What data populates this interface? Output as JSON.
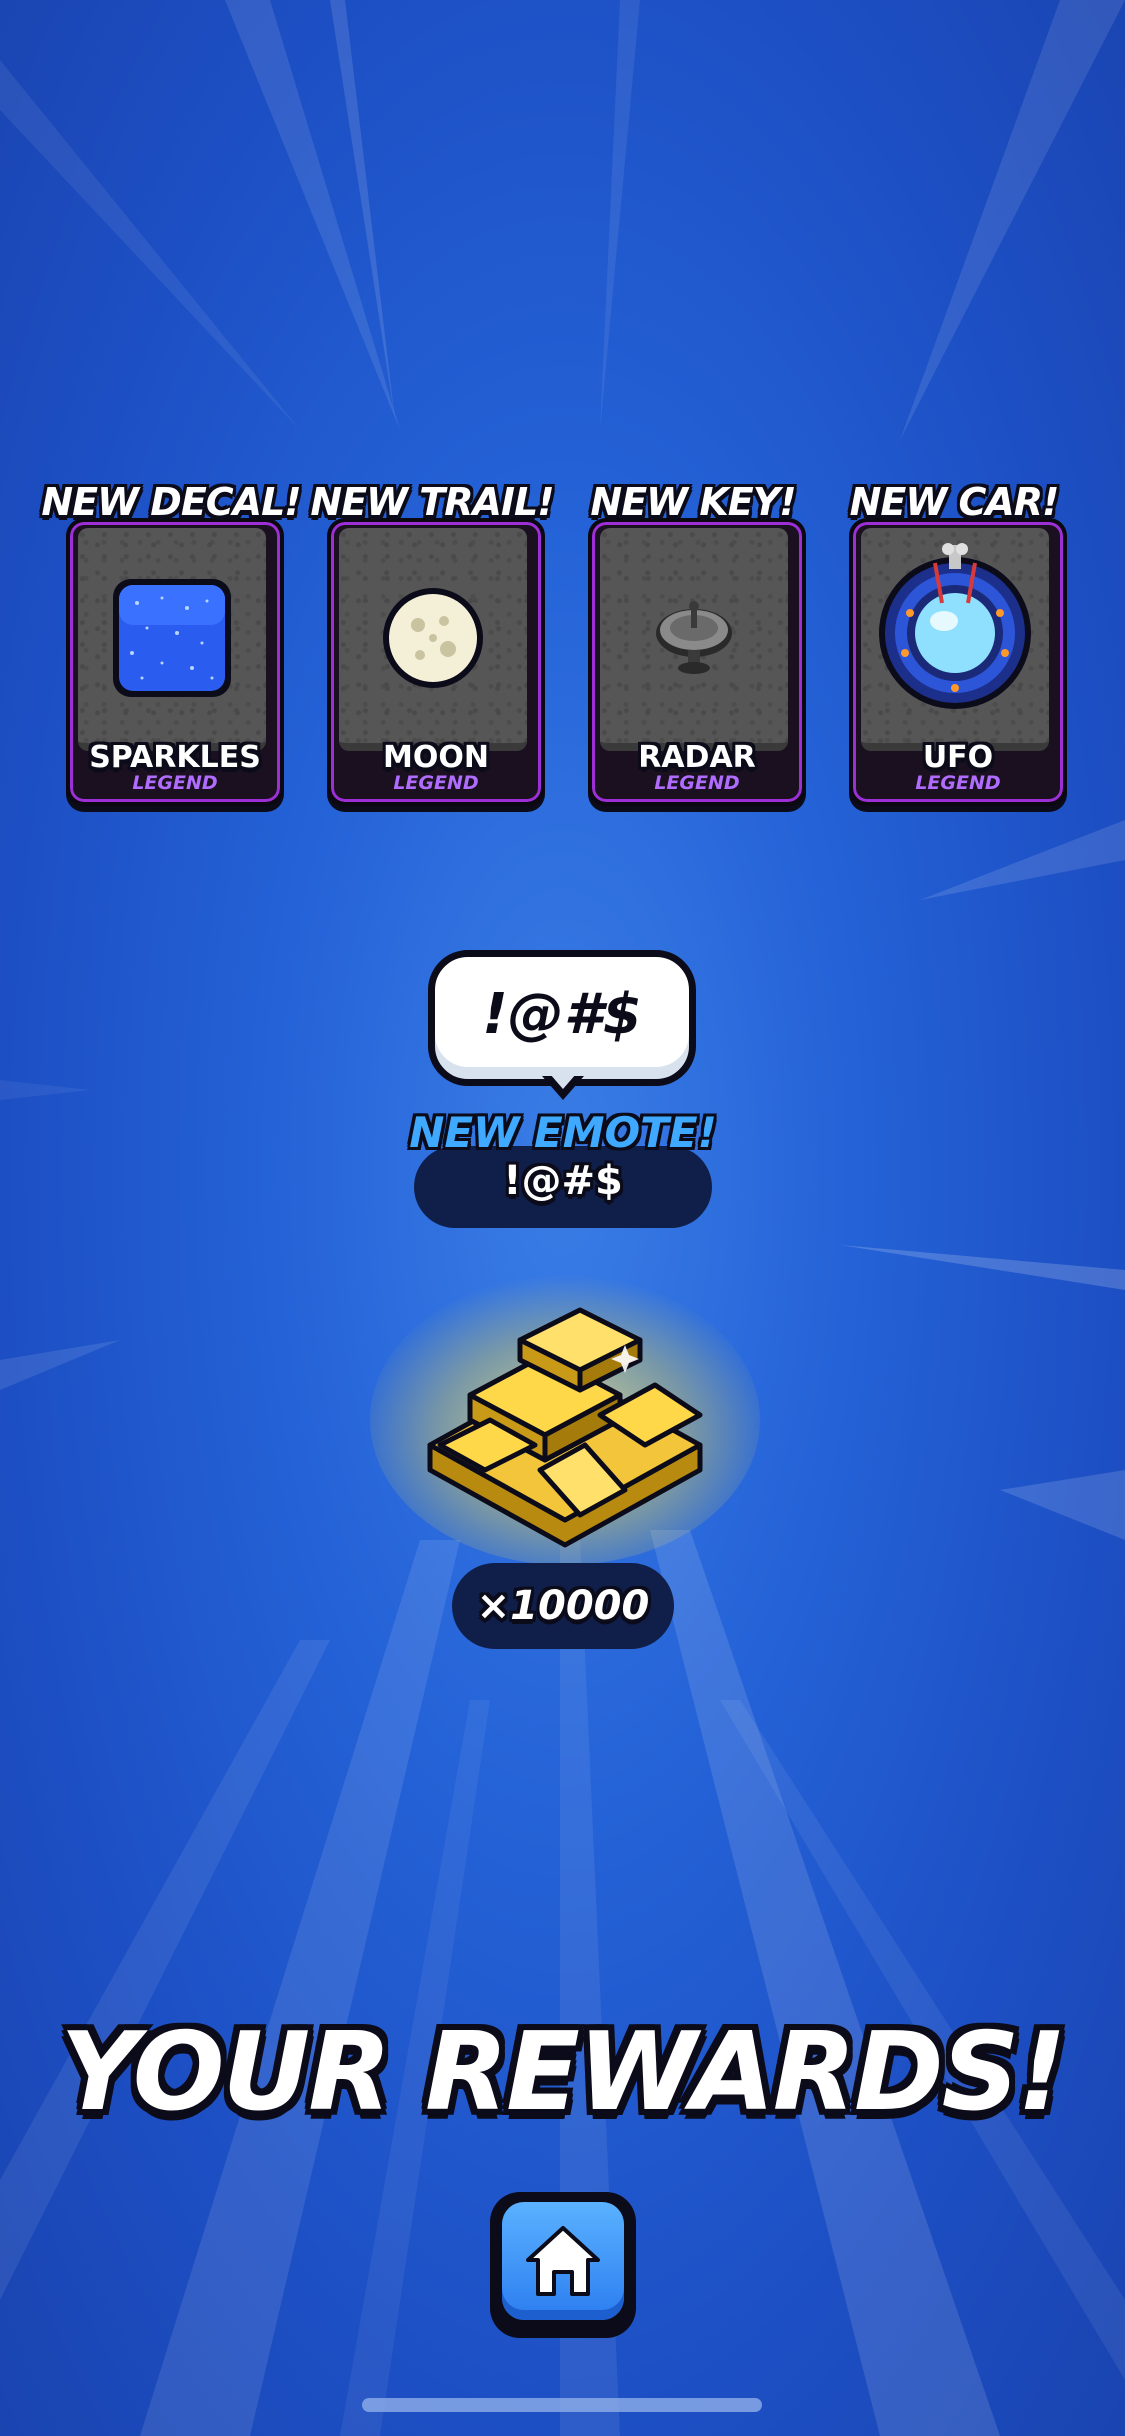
{
  "rewards": [
    {
      "header": "NEW DECAL!",
      "name": "SPARKLES",
      "rarity": "LEGEND",
      "icon": "sparkles-decal-icon"
    },
    {
      "header": "NEW TRAIL!",
      "name": "MOON",
      "rarity": "LEGEND",
      "icon": "moon-trail-icon"
    },
    {
      "header": "NEW KEY!",
      "name": "RADAR",
      "rarity": "LEGEND",
      "icon": "radar-key-icon"
    },
    {
      "header": "NEW CAR!",
      "name": "UFO",
      "rarity": "LEGEND",
      "icon": "ufo-car-icon"
    }
  ],
  "emote": {
    "bubble_text": "!@#$",
    "title": "NEW EMOTE!",
    "name": "!@#$"
  },
  "coins": {
    "amount": "×10000",
    "icon": "coin-pile-icon"
  },
  "title": "YOUR REWARDS!",
  "home_button": {
    "icon": "home-icon"
  },
  "colors": {
    "background": "#2563d8",
    "rarity_legend": "#b06cff",
    "card_border": "#9c2fd6",
    "emote_title": "#3fa8ff",
    "pill": "#0f1f4a",
    "button": "#2b7df0"
  }
}
